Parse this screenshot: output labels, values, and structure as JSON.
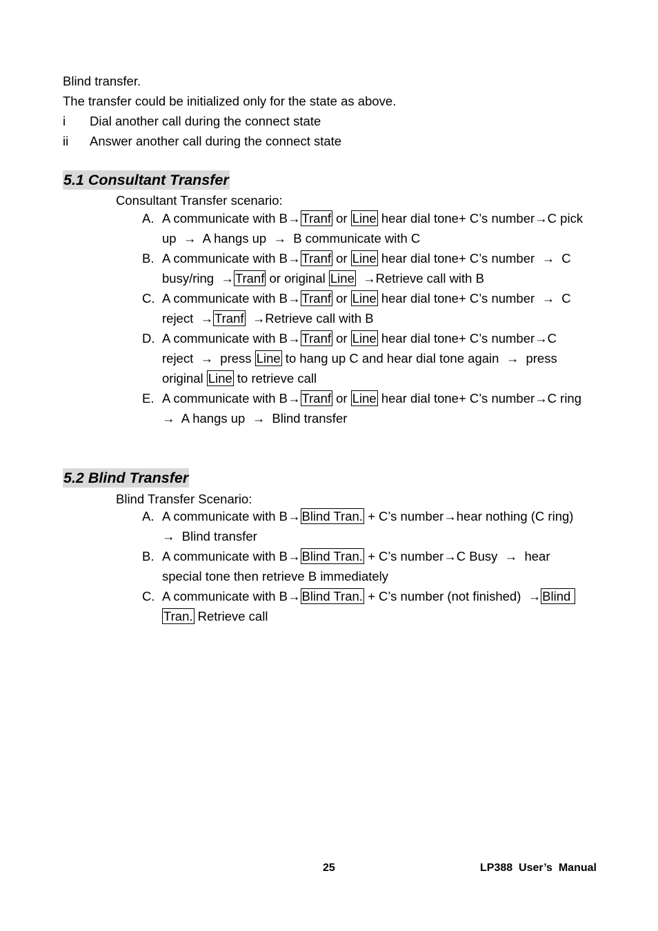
{
  "intro": {
    "line1": "Blind transfer.",
    "line2": "The transfer could be initialized only for the state as above.",
    "list": [
      {
        "num": "i",
        "text": "Dial another call during the connect state"
      },
      {
        "num": "ii",
        "text": "Answer another call during the connect state"
      }
    ]
  },
  "section1": {
    "heading": "5.1 Consultant Transfer",
    "intro": "Consultant Transfer scenario:",
    "items": [
      {
        "letter": "A.",
        "lines": [
          [
            {
              "t": "A communicate with B→"
            },
            {
              "k": "Tranf"
            },
            {
              "t": " or "
            },
            {
              "k": "Line"
            },
            {
              "t": " hear dial tone+ C’s number→C pick"
            }
          ],
          [
            {
              "t": "up  →  A hangs up  →  B communicate with C"
            }
          ]
        ]
      },
      {
        "letter": "B.",
        "lines": [
          [
            {
              "t": "A communicate with B→"
            },
            {
              "k": "Tranf"
            },
            {
              "t": " or "
            },
            {
              "k": "Line"
            },
            {
              "t": " hear dial tone+ C’s number  →  C"
            }
          ],
          [
            {
              "t": "busy/ring  →"
            },
            {
              "k": "Tranf"
            },
            {
              "t": " or original "
            },
            {
              "k": "Line"
            },
            {
              "t": "  →Retrieve call with B"
            }
          ]
        ]
      },
      {
        "letter": "C.",
        "lines": [
          [
            {
              "t": "A communicate with B→"
            },
            {
              "k": "Tranf"
            },
            {
              "t": " or "
            },
            {
              "k": "Line"
            },
            {
              "t": " hear dial tone+ C’s number  →  C"
            }
          ],
          [
            {
              "t": "reject  →"
            },
            {
              "k": "Tranf"
            },
            {
              "t": "  →Retrieve call with B"
            }
          ]
        ]
      },
      {
        "letter": "D.",
        "lines": [
          [
            {
              "t": "A communicate with B→"
            },
            {
              "k": "Tranf"
            },
            {
              "t": " or "
            },
            {
              "k": "Line"
            },
            {
              "t": " hear dial tone+ C’s number→C"
            }
          ],
          [
            {
              "t": "reject  →  press "
            },
            {
              "k": "Line"
            },
            {
              "t": " to hang up C and hear dial tone again  →  press"
            }
          ],
          [
            {
              "t": "original "
            },
            {
              "k": "Line"
            },
            {
              "t": " to retrieve call"
            }
          ]
        ]
      },
      {
        "letter": "E.",
        "lines": [
          [
            {
              "t": "A communicate with B→"
            },
            {
              "k": "Tranf"
            },
            {
              "t": " or "
            },
            {
              "k": "Line"
            },
            {
              "t": " hear dial tone+ C’s number→C ring"
            }
          ],
          [
            {
              "t": "→  A hangs up  →  Blind transfer"
            }
          ]
        ]
      }
    ]
  },
  "section2": {
    "heading": "5.2 Blind Transfer",
    "intro": "Blind Transfer Scenario:",
    "items": [
      {
        "letter": "A.",
        "lines": [
          [
            {
              "t": "A communicate with B→"
            },
            {
              "k": "Blind Tran."
            },
            {
              "t": " + C’s number→hear nothing (C ring)"
            }
          ],
          [
            {
              "t": "→  Blind transfer"
            }
          ]
        ]
      },
      {
        "letter": "B.",
        "lines": [
          [
            {
              "t": "A communicate with B→"
            },
            {
              "k": "Blind Tran."
            },
            {
              "t": " + C’s number→C Busy  →  hear"
            }
          ],
          [
            {
              "t": "special tone then retrieve B immediately"
            }
          ]
        ]
      },
      {
        "letter": "C.",
        "lines": [
          [
            {
              "t": "A communicate with B→"
            },
            {
              "k": "Blind Tran."
            },
            {
              "t": " + C’s number (not finished)  →"
            },
            {
              "k": "Blind "
            }
          ],
          [
            {
              "k": "Tran."
            },
            {
              "t": " Retrieve call"
            }
          ]
        ]
      }
    ]
  },
  "footer": {
    "page_number": "25",
    "manual_title": "LP388  User’s  Manual"
  }
}
